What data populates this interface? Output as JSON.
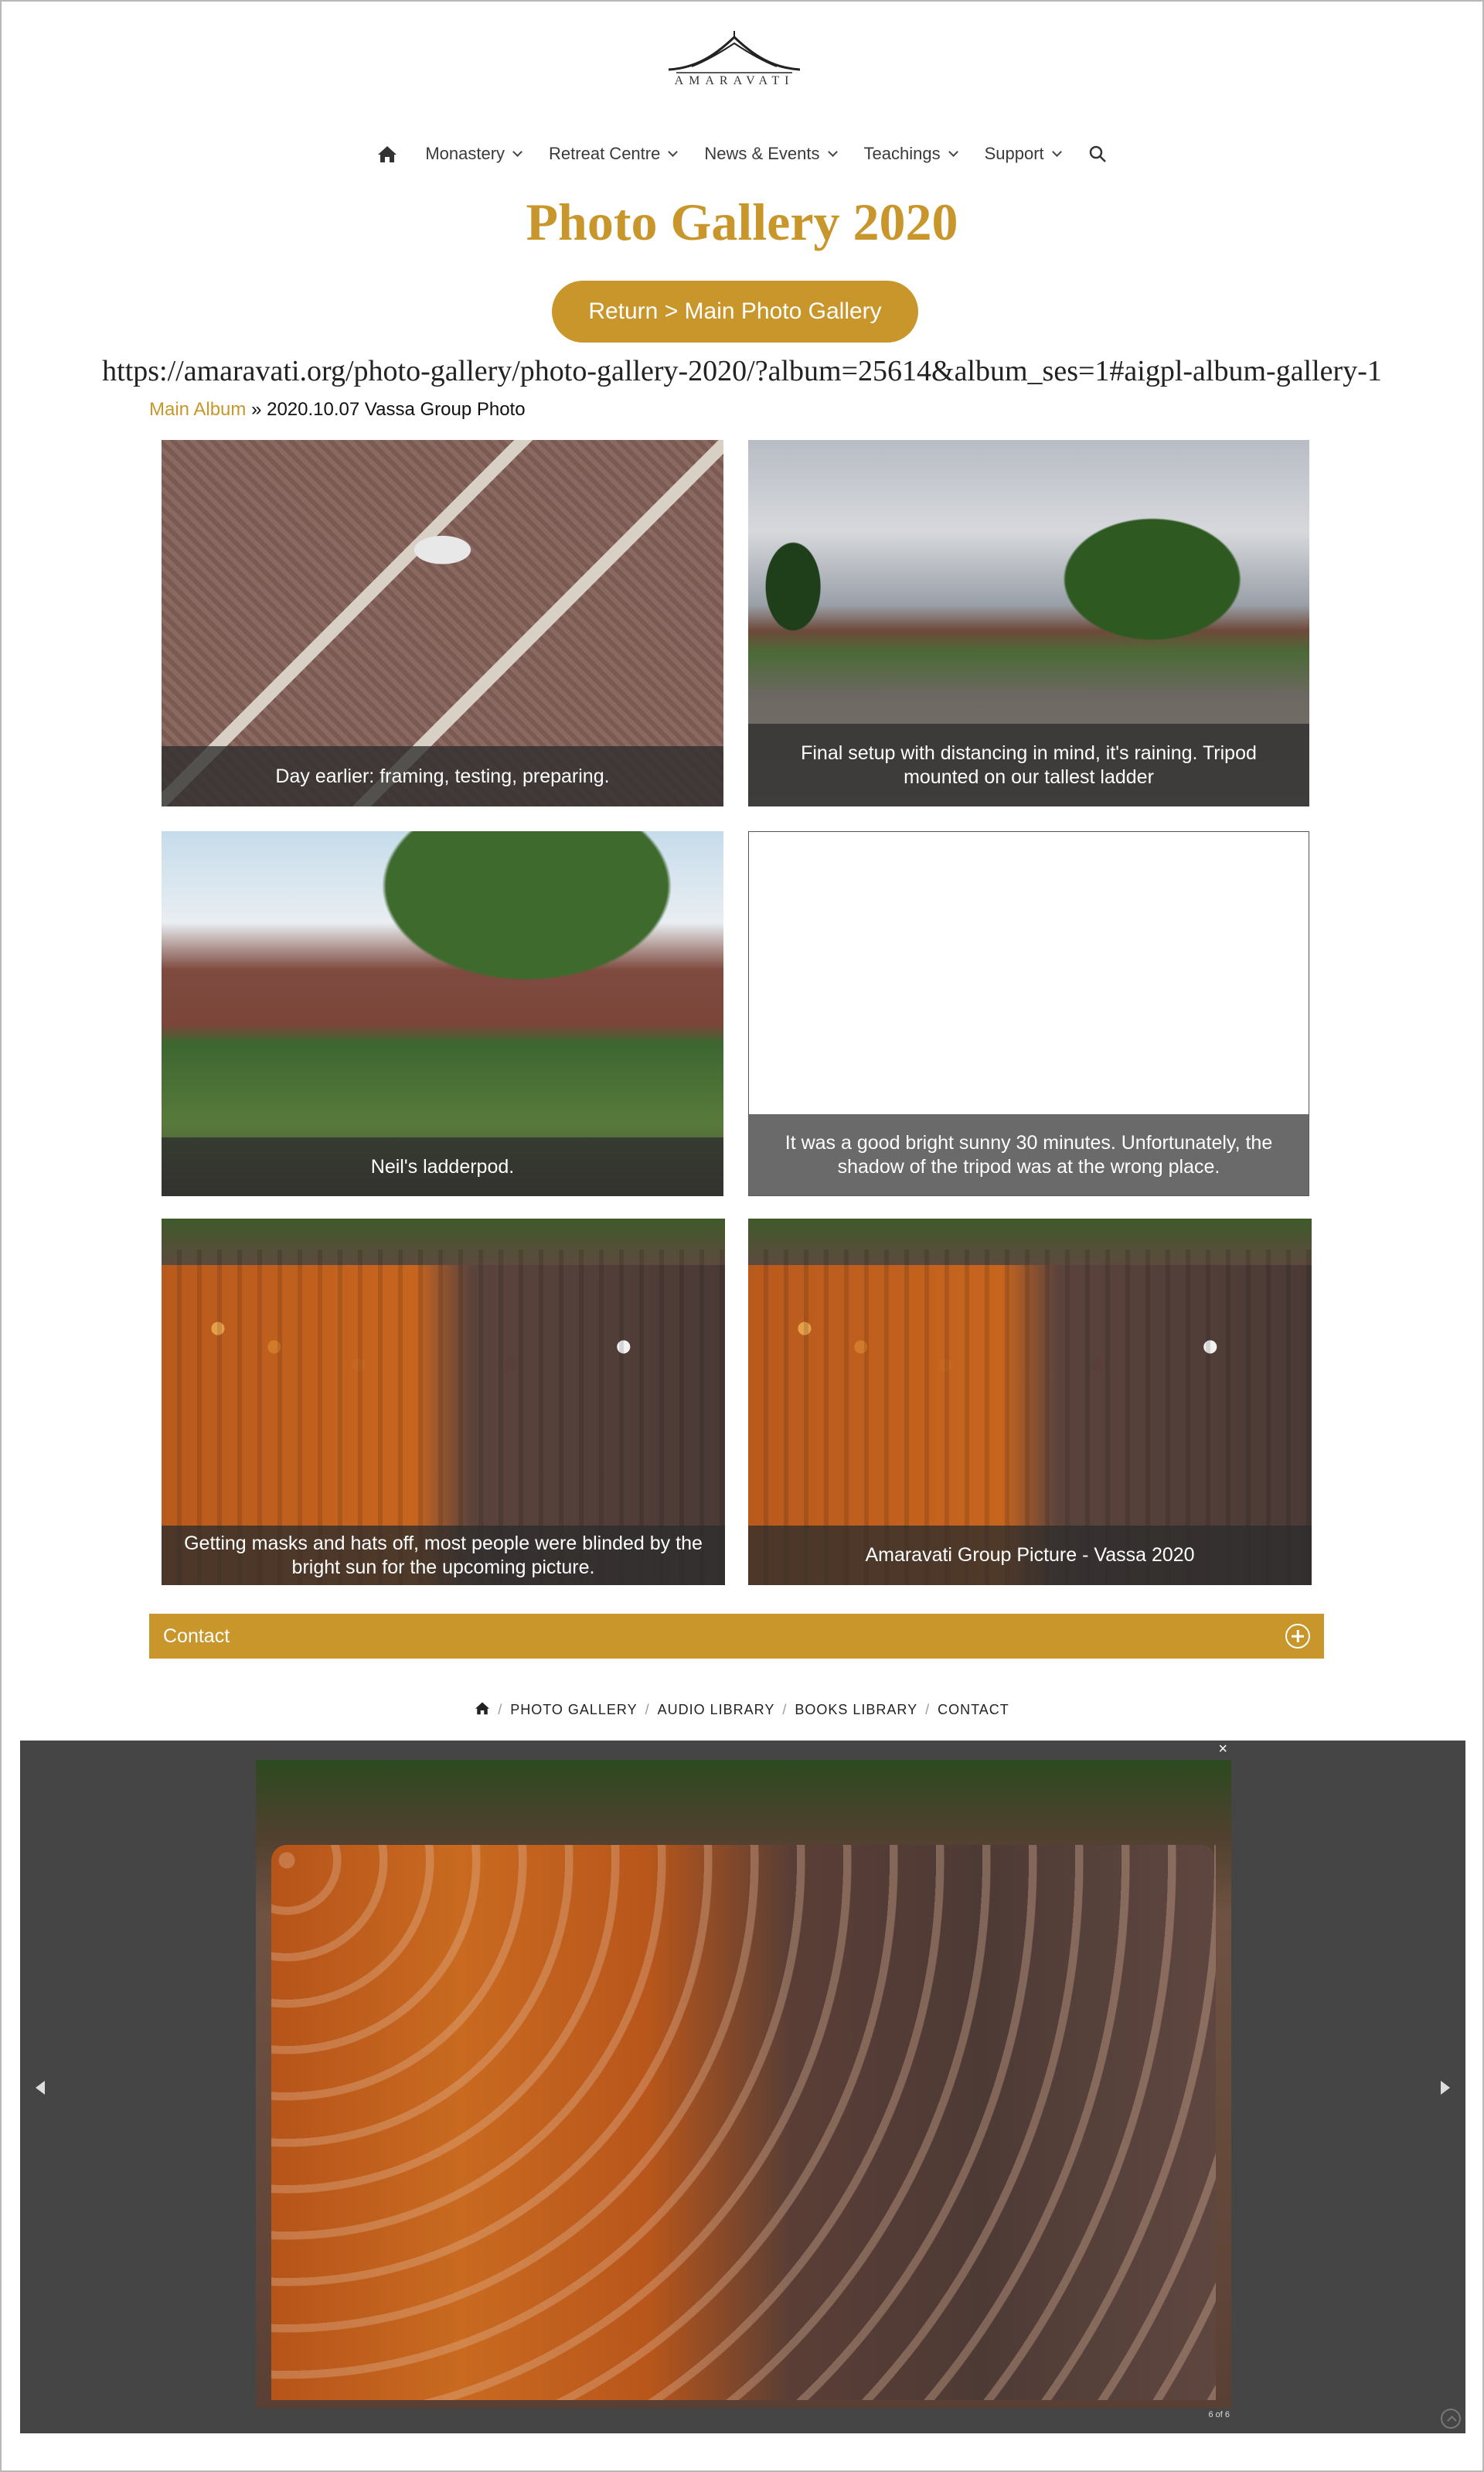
{
  "site": {
    "logo_text": "AMARAVATI"
  },
  "nav": {
    "items": [
      {
        "label": "Monastery"
      },
      {
        "label": "Retreat Centre"
      },
      {
        "label": "News & Events"
      },
      {
        "label": "Teachings"
      },
      {
        "label": "Support"
      }
    ]
  },
  "page": {
    "title": "Photo Gallery 2020",
    "return_button": "Return > Main Photo Gallery",
    "url_text": "https://amaravati.org/photo-gallery/photo-gallery-2020/?album=25614&album_ses=1#aigpl-album-gallery-1"
  },
  "breadcrumb": {
    "link": "Main Album",
    "separator": "»",
    "current": "2020.10.07 Vassa Group Photo"
  },
  "gallery": [
    {
      "caption": "Day earlier: framing, testing, preparing."
    },
    {
      "caption": "Final setup with distancing in mind, it's raining. Tripod mounted on our tallest ladder"
    },
    {
      "caption": "Neil's ladderpod."
    },
    {
      "caption": "It was a good bright sunny 30 minutes. Unfortunately, the shadow of the tripod was at the wrong place."
    },
    {
      "caption": "Getting masks and hats off, most people were blinded by the bright sun for the upcoming picture."
    },
    {
      "caption": "Amaravati Group Picture - Vassa 2020"
    }
  ],
  "contact": {
    "label": "Contact"
  },
  "footer_nav": {
    "items": [
      "PHOTO GALLERY",
      "AUDIO LIBRARY",
      "BOOKS LIBRARY",
      "CONTACT"
    ],
    "separator": "/"
  },
  "lightbox": {
    "close": "×",
    "counter": "6 of 6"
  },
  "colors": {
    "accent": "#c9962b",
    "lightbox_bg": "#454545"
  }
}
